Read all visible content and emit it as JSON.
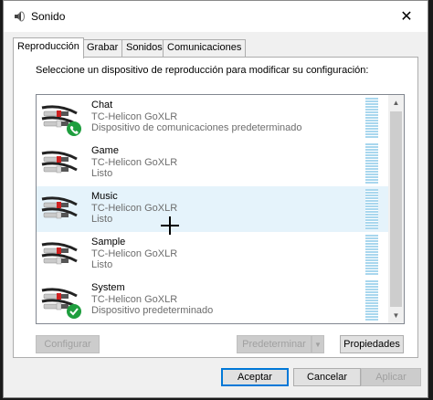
{
  "window": {
    "title": "Sonido",
    "close_glyph": "✕"
  },
  "tabs": [
    {
      "label": "Reproducción",
      "active": true
    },
    {
      "label": "Grabar",
      "active": false
    },
    {
      "label": "Sonidos",
      "active": false
    },
    {
      "label": "Comunicaciones",
      "active": false
    }
  ],
  "instruction": "Seleccione un dispositivo de reproducción para modificar su configuración:",
  "devices": [
    {
      "name": "Chat",
      "driver": "TC-Helicon GoXLR",
      "status": "Dispositivo de comunicaciones predeterminado",
      "badge": "phone-badge-icon",
      "selected": false
    },
    {
      "name": "Game",
      "driver": "TC-Helicon GoXLR",
      "status": "Listo",
      "badge": "",
      "selected": false
    },
    {
      "name": "Music",
      "driver": "TC-Helicon GoXLR",
      "status": "Listo",
      "badge": "",
      "selected": true
    },
    {
      "name": "Sample",
      "driver": "TC-Helicon GoXLR",
      "status": "Listo",
      "badge": "",
      "selected": false
    },
    {
      "name": "System",
      "driver": "TC-Helicon GoXLR",
      "status": "Dispositivo predeterminado",
      "badge": "check-badge-icon",
      "selected": false
    }
  ],
  "buttons": {
    "configure": "Configurar",
    "set_default": "Predeterminar",
    "properties": "Propiedades",
    "ok": "Aceptar",
    "cancel": "Cancelar",
    "apply": "Aplicar"
  },
  "colors": {
    "selection": "#e5f3fb",
    "meter": "#a9d7ee",
    "badge_green": "#1e9e3e",
    "primary_border": "#0078d7"
  }
}
